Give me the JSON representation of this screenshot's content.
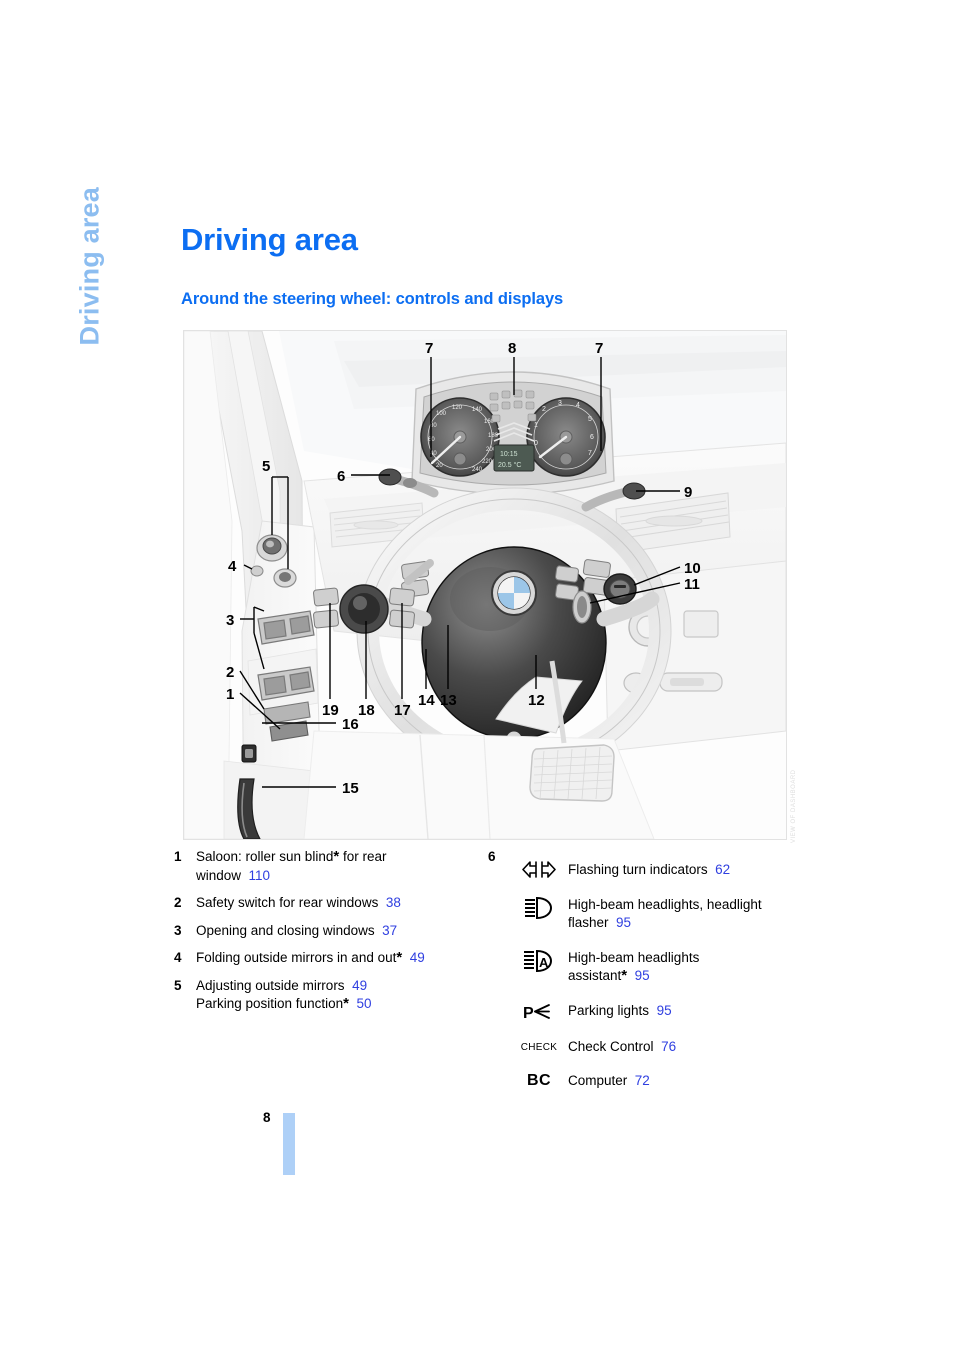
{
  "side_tab": {
    "label": "Driving area"
  },
  "headings": {
    "page_title": "Driving area",
    "section_title": "Around the steering wheel: controls and displays"
  },
  "illustration": {
    "alt": "Driver's side interior view: door panel switches, steering wheel, instrument cluster, pedals",
    "callouts": [
      "1",
      "2",
      "3",
      "4",
      "5",
      "6",
      "7",
      "8",
      "9",
      "10",
      "11",
      "12",
      "13",
      "14",
      "15",
      "16",
      "17",
      "18",
      "19"
    ],
    "credit": "VIEW OF DASHBOARD"
  },
  "legend": {
    "left": [
      {
        "num": "1",
        "line1": "Saloon: roller sun blind",
        "star1": "*",
        "line1b": " for rear",
        "line2": "window",
        "page2": "110"
      },
      {
        "num": "2",
        "line1": "Safety switch for rear windows",
        "page1": "38"
      },
      {
        "num": "3",
        "line1": "Opening and closing windows",
        "page1": "37"
      },
      {
        "num": "4",
        "line1": "Folding outside mirrors in and out",
        "star1": "*",
        "page1": "49"
      },
      {
        "num": "5",
        "line1": "Adjusting outside mirrors",
        "page1": "49",
        "line2": "Parking position function",
        "star2": "*",
        "page2": "50"
      }
    ],
    "group6": {
      "num": "6",
      "items": [
        {
          "icon": "turn-indicator-icon",
          "label": "Flashing turn indicators",
          "page": "62"
        },
        {
          "icon": "high-beam-icon",
          "label": "High-beam headlights, headlight",
          "label2": "flasher",
          "page": "95"
        },
        {
          "icon": "high-beam-assistant-icon",
          "label": "High-beam headlights",
          "label2": "assistant",
          "star": "*",
          "page": "95"
        },
        {
          "icon": "parking-lights-icon",
          "label": "Parking lights",
          "page": "95"
        },
        {
          "icon": "check-control-icon",
          "icon_text": "CHECK",
          "label": "Check Control",
          "page": "76"
        },
        {
          "icon": "computer-icon",
          "icon_text": "BC",
          "label": "Computer",
          "page": "72"
        }
      ]
    }
  },
  "footer": {
    "page_number": "8"
  },
  "colors": {
    "heading_blue": "#0c6ef2",
    "tab_blue": "#8CBDF0",
    "reference_blue": "#2f3fe0",
    "footer_bar": "#aed0f7"
  }
}
